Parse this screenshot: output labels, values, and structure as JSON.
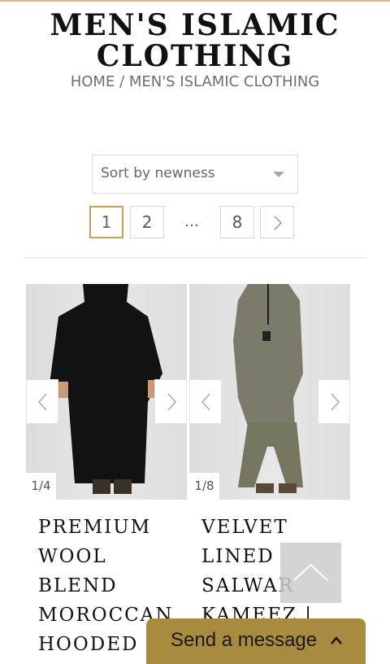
{
  "page": {
    "title_line1": "MEN'S ISLAMIC",
    "title_line2": "CLOTHING",
    "breadcrumb": {
      "home": "HOME",
      "separator": "/",
      "current": "MEN'S ISLAMIC CLOTHING"
    }
  },
  "sort": {
    "selected": "Sort by newness"
  },
  "pagination": {
    "pages": [
      "1",
      "2",
      "…",
      "8"
    ],
    "current": "1"
  },
  "products": [
    {
      "counter": "1/4",
      "title_lines": [
        "PREMIUM",
        "WOOL",
        "BLEND",
        "MOROCCAN",
        "HOODED"
      ],
      "garment_color": "#121212"
    },
    {
      "counter": "1/8",
      "title_lines": [
        "VELVET",
        "LINED",
        "SALWAR",
        "KAMEEZ |"
      ],
      "garment_color": "#7c7b6b"
    }
  ],
  "chat": {
    "label": "Send a message"
  },
  "colors": {
    "accent": "#c3a25c",
    "chat_bg": "#a88a40"
  }
}
